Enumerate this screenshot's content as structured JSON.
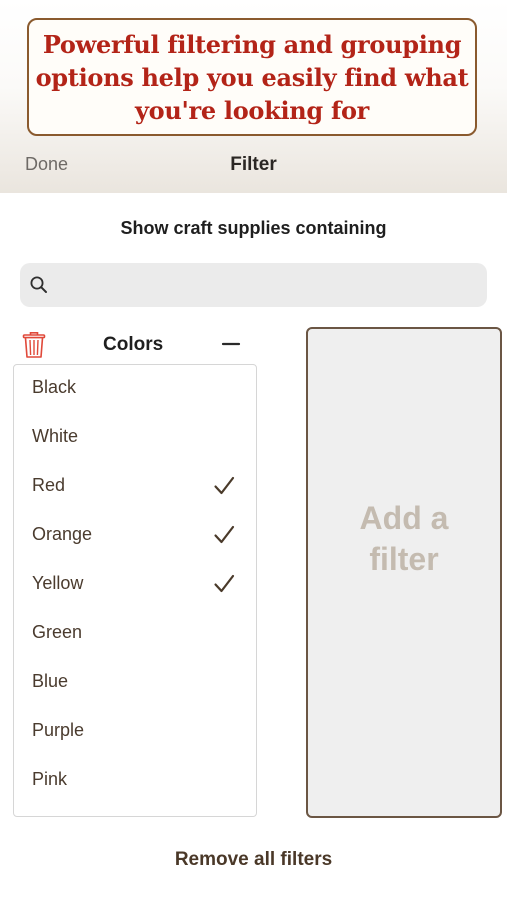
{
  "promo": {
    "text": "Powerful filtering and grouping options help you easily find what you're looking for"
  },
  "navbar": {
    "done_label": "Done",
    "title": "Filter"
  },
  "heading": "Show craft supplies containing",
  "search": {
    "value": "",
    "placeholder": ""
  },
  "filter": {
    "title": "Colors",
    "options": [
      {
        "label": "Black",
        "checked": false
      },
      {
        "label": "White",
        "checked": false
      },
      {
        "label": "Red",
        "checked": true
      },
      {
        "label": "Orange",
        "checked": true
      },
      {
        "label": "Yellow",
        "checked": true
      },
      {
        "label": "Green",
        "checked": false
      },
      {
        "label": "Blue",
        "checked": false
      },
      {
        "label": "Purple",
        "checked": false
      },
      {
        "label": "Pink",
        "checked": false
      }
    ]
  },
  "add_filter_label": "Add a filter",
  "remove_all_label": "Remove all filters",
  "colors": {
    "promo_text": "#b32418",
    "promo_border": "#8a5a2e",
    "trash": "#e0493a",
    "check": "#4a3a2a"
  }
}
